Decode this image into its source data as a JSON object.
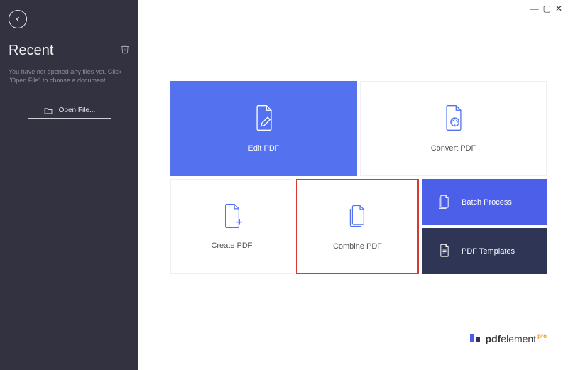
{
  "window": {
    "min": "—",
    "max": "▢",
    "close": "✕"
  },
  "sidebar": {
    "recent_title": "Recent",
    "hint": "You have not opened any files yet. Click \"Open File\" to choose a document.",
    "open_file_label": "Open File..."
  },
  "tiles": {
    "edit": "Edit PDF",
    "convert": "Convert PDF",
    "create": "Create PDF",
    "combine": "Combine PDF",
    "batch": "Batch Process",
    "templates": "PDF Templates"
  },
  "brand": {
    "pdf": "pdf",
    "element": "element",
    "pro": "pro"
  }
}
